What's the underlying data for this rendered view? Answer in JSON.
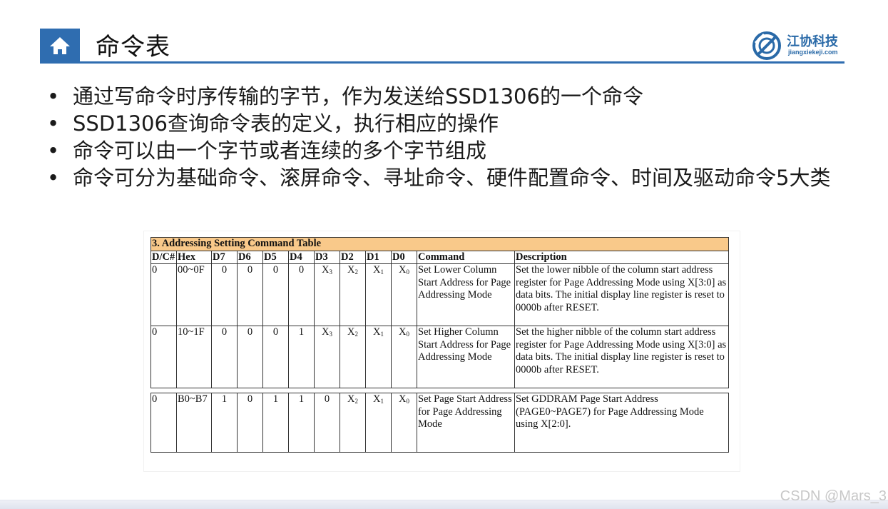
{
  "header": {
    "title": "命令表",
    "logo_name": "江协科技",
    "logo_domain": "jiangxiekeji.com"
  },
  "bullets": [
    "通过写命令时序传输的字节，作为发送给SSD1306的一个命令",
    "SSD1306查询命令表的定义，执行相应的操作",
    "命令可以由一个字节或者连续的多个字节组成",
    "命令可分为基础命令、滚屏命令、寻址命令、硬件配置命令、时间及驱动命令5大类"
  ],
  "bullet_symbol": "•",
  "table": {
    "caption": "3. Addressing Setting Command Table",
    "headers": [
      "D/C#",
      "Hex",
      "D7",
      "D6",
      "D5",
      "D4",
      "D3",
      "D2",
      "D1",
      "D0",
      "Command",
      "Description"
    ],
    "rows": [
      {
        "dc": "0",
        "hex": "00~0F",
        "bits": [
          "0",
          "0",
          "0",
          "0"
        ],
        "x_bits": [
          [
            "X",
            "3"
          ],
          [
            "X",
            "2"
          ],
          [
            "X",
            "1"
          ],
          [
            "X",
            "0"
          ]
        ],
        "command": "Set Lower Column Start Address for Page Addressing Mode",
        "description": "Set the lower nibble of the column start address register for Page Addressing Mode using X[3:0] as data bits. The initial display line register is reset to 0000b after RESET."
      },
      {
        "dc": "0",
        "hex": "10~1F",
        "bits": [
          "0",
          "0",
          "0",
          "1"
        ],
        "x_bits": [
          [
            "X",
            "3"
          ],
          [
            "X",
            "2"
          ],
          [
            "X",
            "1"
          ],
          [
            "X",
            "0"
          ]
        ],
        "command": "Set Higher Column Start Address for Page Addressing Mode",
        "description": "Set the higher nibble of the column start address register for Page Addressing Mode using X[3:0] as data bits. The initial display line register is reset to 0000b after RESET."
      },
      {
        "dc": "0",
        "hex": "B0~B7",
        "bits": [
          "1",
          "0",
          "1",
          "1",
          "0"
        ],
        "x_bits": [
          [
            "X",
            "2"
          ],
          [
            "X",
            "1"
          ],
          [
            "X",
            "0"
          ]
        ],
        "command": "Set Page Start Address for Page Addressing Mode",
        "description": "Set GDDRAM Page Start Address (PAGE0~PAGE7) for Page Addressing Mode using X[2:0]."
      }
    ]
  },
  "watermark": "CSDN @Mars_3",
  "colors": {
    "accent": "#2f6db0",
    "table_caption_bg": "#f9c98a",
    "logo": "#2a6aa8"
  }
}
